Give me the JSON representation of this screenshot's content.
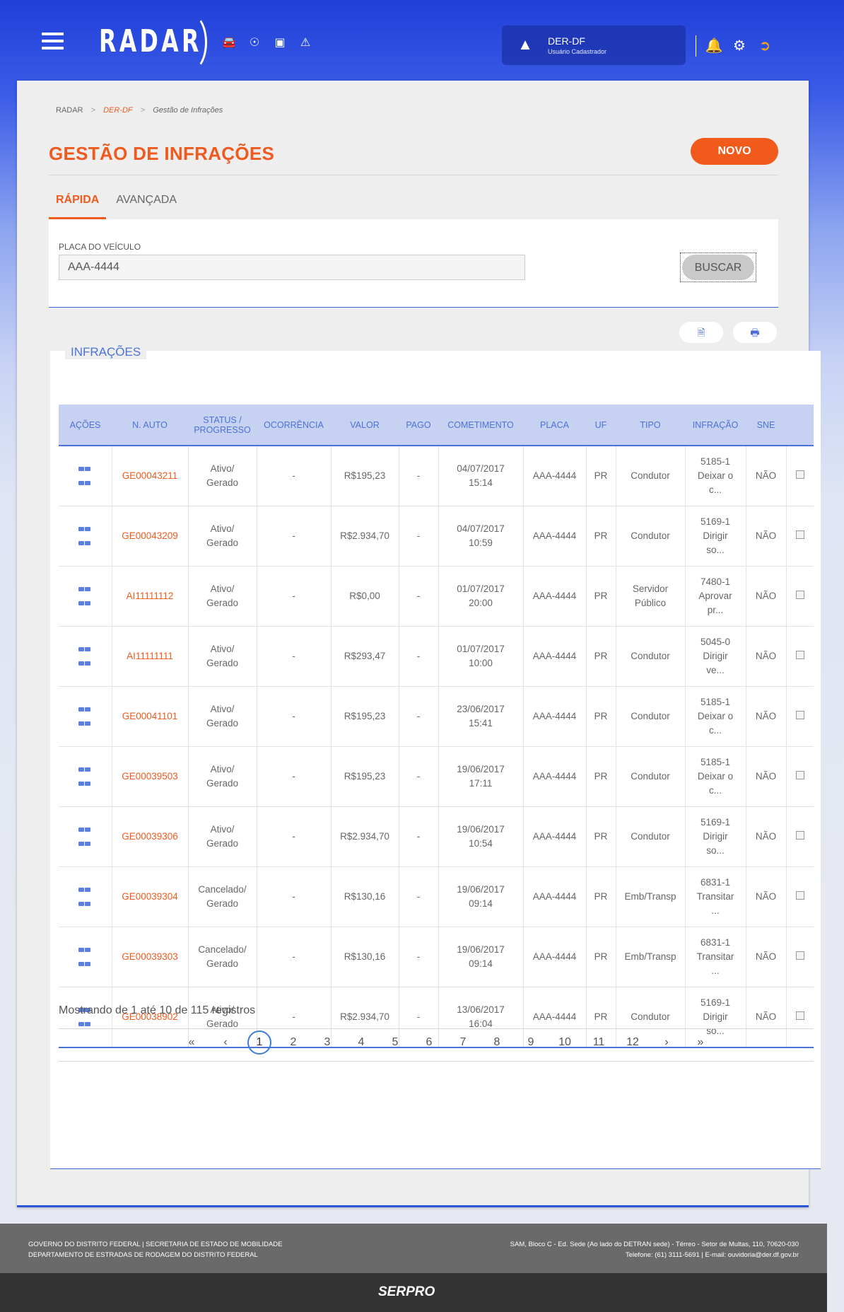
{
  "app": {
    "logo": "RADAR",
    "org_name": "DER-DF",
    "org_role": "Usuário Cadastrador"
  },
  "breadcrumb": [
    "RADAR",
    "DER-DF",
    "Gestão de Infrações"
  ],
  "page_title": "GESTÃO DE INFRAÇÕES",
  "new_button": "NOVO",
  "tabs": [
    "RÁPIDA",
    "AVANÇADA"
  ],
  "search": {
    "label": "PLACA DO VEÍCULO",
    "value": "AAA-4444",
    "button": "BUSCAR"
  },
  "section_title": "INFRAÇÕES",
  "table": {
    "headers": [
      "AÇÕES",
      "N. AUTO",
      "STATUS / PROGRESSO",
      "OCORRÊNCIA",
      "VALOR",
      "PAGO",
      "COMETIMENTO",
      "PLACA",
      "UF",
      "TIPO",
      "INFRAÇÃO",
      "SNE",
      ""
    ],
    "rows": [
      {
        "auto": "GE00043211",
        "status1": "Ativo/",
        "status2": "Gerado",
        "ocorrencia": "-",
        "valor": "R$195,23",
        "pago": "-",
        "data": "04/07/2017",
        "hora": "15:14",
        "placa": "AAA-4444",
        "uf": "PR",
        "tipo1": "Condutor",
        "tipo2": "",
        "inf1": "5185-1",
        "inf2": "Deixar o",
        "inf3": "c...",
        "sne": "NÃO"
      },
      {
        "auto": "GE00043209",
        "status1": "Ativo/",
        "status2": "Gerado",
        "ocorrencia": "-",
        "valor": "R$2.934,70",
        "pago": "-",
        "data": "04/07/2017",
        "hora": "10:59",
        "placa": "AAA-4444",
        "uf": "PR",
        "tipo1": "Condutor",
        "tipo2": "",
        "inf1": "5169-1",
        "inf2": "Dirigir",
        "inf3": "so...",
        "sne": "NÃO"
      },
      {
        "auto": "AI11111112",
        "status1": "Ativo/",
        "status2": "Gerado",
        "ocorrencia": "-",
        "valor": "R$0,00",
        "pago": "-",
        "data": "01/07/2017",
        "hora": "20:00",
        "placa": "AAA-4444",
        "uf": "PR",
        "tipo1": "Servidor",
        "tipo2": "Público",
        "inf1": "7480-1",
        "inf2": "Aprovar",
        "inf3": "pr...",
        "sne": "NÃO"
      },
      {
        "auto": "AI11111111",
        "status1": "Ativo/",
        "status2": "Gerado",
        "ocorrencia": "-",
        "valor": "R$293,47",
        "pago": "-",
        "data": "01/07/2017",
        "hora": "10:00",
        "placa": "AAA-4444",
        "uf": "PR",
        "tipo1": "Condutor",
        "tipo2": "",
        "inf1": "5045-0",
        "inf2": "Dirigir",
        "inf3": "ve...",
        "sne": "NÃO"
      },
      {
        "auto": "GE00041101",
        "status1": "Ativo/",
        "status2": "Gerado",
        "ocorrencia": "-",
        "valor": "R$195,23",
        "pago": "-",
        "data": "23/06/2017",
        "hora": "15:41",
        "placa": "AAA-4444",
        "uf": "PR",
        "tipo1": "Condutor",
        "tipo2": "",
        "inf1": "5185-1",
        "inf2": "Deixar o",
        "inf3": "c...",
        "sne": "NÃO"
      },
      {
        "auto": "GE00039503",
        "status1": "Ativo/",
        "status2": "Gerado",
        "ocorrencia": "-",
        "valor": "R$195,23",
        "pago": "-",
        "data": "19/06/2017",
        "hora": "17:11",
        "placa": "AAA-4444",
        "uf": "PR",
        "tipo1": "Condutor",
        "tipo2": "",
        "inf1": "5185-1",
        "inf2": "Deixar o",
        "inf3": "c...",
        "sne": "NÃO"
      },
      {
        "auto": "GE00039306",
        "status1": "Ativo/",
        "status2": "Gerado",
        "ocorrencia": "-",
        "valor": "R$2.934,70",
        "pago": "-",
        "data": "19/06/2017",
        "hora": "10:54",
        "placa": "AAA-4444",
        "uf": "PR",
        "tipo1": "Condutor",
        "tipo2": "",
        "inf1": "5169-1",
        "inf2": "Dirigir",
        "inf3": "so...",
        "sne": "NÃO"
      },
      {
        "auto": "GE00039304",
        "status1": "Cancelado/",
        "status2": "Gerado",
        "ocorrencia": "-",
        "valor": "R$130,16",
        "pago": "-",
        "data": "19/06/2017",
        "hora": "09:14",
        "placa": "AAA-4444",
        "uf": "PR",
        "tipo1": "Emb/Transp",
        "tipo2": "",
        "inf1": "6831-1",
        "inf2": "Transitar",
        "inf3": "...",
        "sne": "NÃO"
      },
      {
        "auto": "GE00039303",
        "status1": "Cancelado/",
        "status2": "Gerado",
        "ocorrencia": "-",
        "valor": "R$130,16",
        "pago": "-",
        "data": "19/06/2017",
        "hora": "09:14",
        "placa": "AAA-4444",
        "uf": "PR",
        "tipo1": "Emb/Transp",
        "tipo2": "",
        "inf1": "6831-1",
        "inf2": "Transitar",
        "inf3": "...",
        "sne": "NÃO"
      },
      {
        "auto": "GE00038902",
        "status1": "Ativo/",
        "status2": "Gerado",
        "ocorrencia": "-",
        "valor": "R$2.934,70",
        "pago": "-",
        "data": "13/06/2017",
        "hora": "16:04",
        "placa": "AAA-4444",
        "uf": "PR",
        "tipo1": "Condutor",
        "tipo2": "",
        "inf1": "5169-1",
        "inf2": "Dirigir",
        "inf3": "so...",
        "sne": "NÃO"
      }
    ]
  },
  "info": "Mostrando de 1 até 10 de 115 registros",
  "pagination": {
    "first": "«",
    "prev": "‹",
    "next": "›",
    "last": "»",
    "pages": [
      "1",
      "2",
      "3",
      "4",
      "5",
      "6",
      "7",
      "8",
      "9",
      "10",
      "11",
      "12"
    ],
    "current": "1"
  },
  "footer": {
    "left1": "GOVERNO DO DISTRITO FEDERAL | SECRETARIA DE ESTADO DE MOBILIDADE",
    "left2": "DEPARTAMENTO DE ESTRADAS DE RODAGEM DO DISTRITO FEDERAL",
    "right1": "SAM, Bloco C - Ed. Sede (Ao lado do DETRAN sede) - Térreo - Setor de Multas, 110, 70620-030",
    "right2": "Telefone: (61) 3111-5691 | E-mail: ouvidoria@der.df.gov.br",
    "brand": "SERPRO"
  }
}
